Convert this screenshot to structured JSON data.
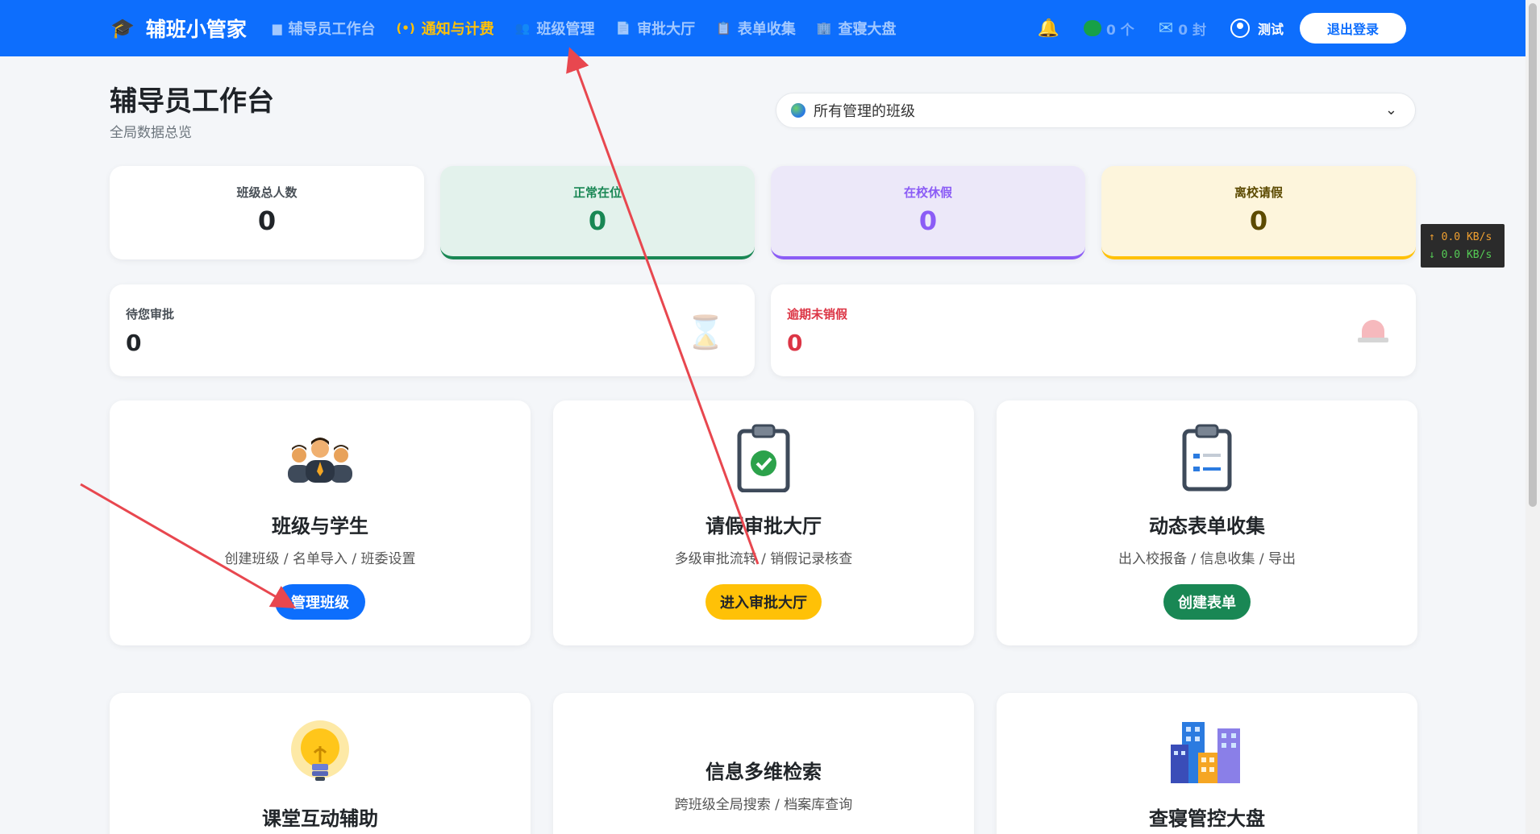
{
  "nav": {
    "brand": "辅班小管家",
    "items": [
      {
        "label": "辅导员工作台",
        "icon": "dashboard-icon"
      },
      {
        "label": "通知与计费",
        "icon": "broadcast-icon",
        "active": true
      },
      {
        "label": "班级管理",
        "icon": "users-icon"
      },
      {
        "label": "审批大厅",
        "icon": "document-icon"
      },
      {
        "label": "表单收集",
        "icon": "form-icon"
      },
      {
        "label": "查寝大盘",
        "icon": "building-icon"
      }
    ],
    "wechat_count": "0 个",
    "mail_count": "0 封",
    "user_name": "测试",
    "logout_label": "退出登录"
  },
  "page": {
    "title": "辅导员工作台",
    "subtitle": "全局数据总览",
    "class_filter": "所有管理的班级"
  },
  "stats": [
    {
      "label": "班级总人数",
      "value": "0",
      "color": "#212529"
    },
    {
      "label": "正常在位",
      "value": "0",
      "color": "#198754"
    },
    {
      "label": "在校休假",
      "value": "0",
      "color": "#8b5cf6"
    },
    {
      "label": "离校请假",
      "value": "0",
      "color": "#5c4a00"
    }
  ],
  "pending": [
    {
      "label": "待您审批",
      "value": "0"
    },
    {
      "label": "逾期未销假",
      "value": "0"
    }
  ],
  "modules": [
    {
      "title": "班级与学生",
      "desc": "创建班级 / 名单导入 / 班委设置",
      "button": "管理班级"
    },
    {
      "title": "请假审批大厅",
      "desc": "多级审批流转 / 销假记录核查",
      "button": "进入审批大厅"
    },
    {
      "title": "动态表单收集",
      "desc": "出入校报备 / 信息收集 / 导出",
      "button": "创建表单"
    },
    {
      "title": "课堂互动辅助",
      "desc": "",
      "button": ""
    },
    {
      "title": "信息多维检索",
      "desc": "跨班级全局搜索 / 档案库查询",
      "button": ""
    },
    {
      "title": "查寝管控大盘",
      "desc": "",
      "button": ""
    }
  ],
  "netspeed": {
    "up": "↑ 0.0 KB/s",
    "down": "↓ 0.0 KB/s"
  },
  "colors": {
    "primary": "#0d6efd",
    "active_nav": "#ffc107",
    "annotation_arrow": "#e8474f"
  }
}
